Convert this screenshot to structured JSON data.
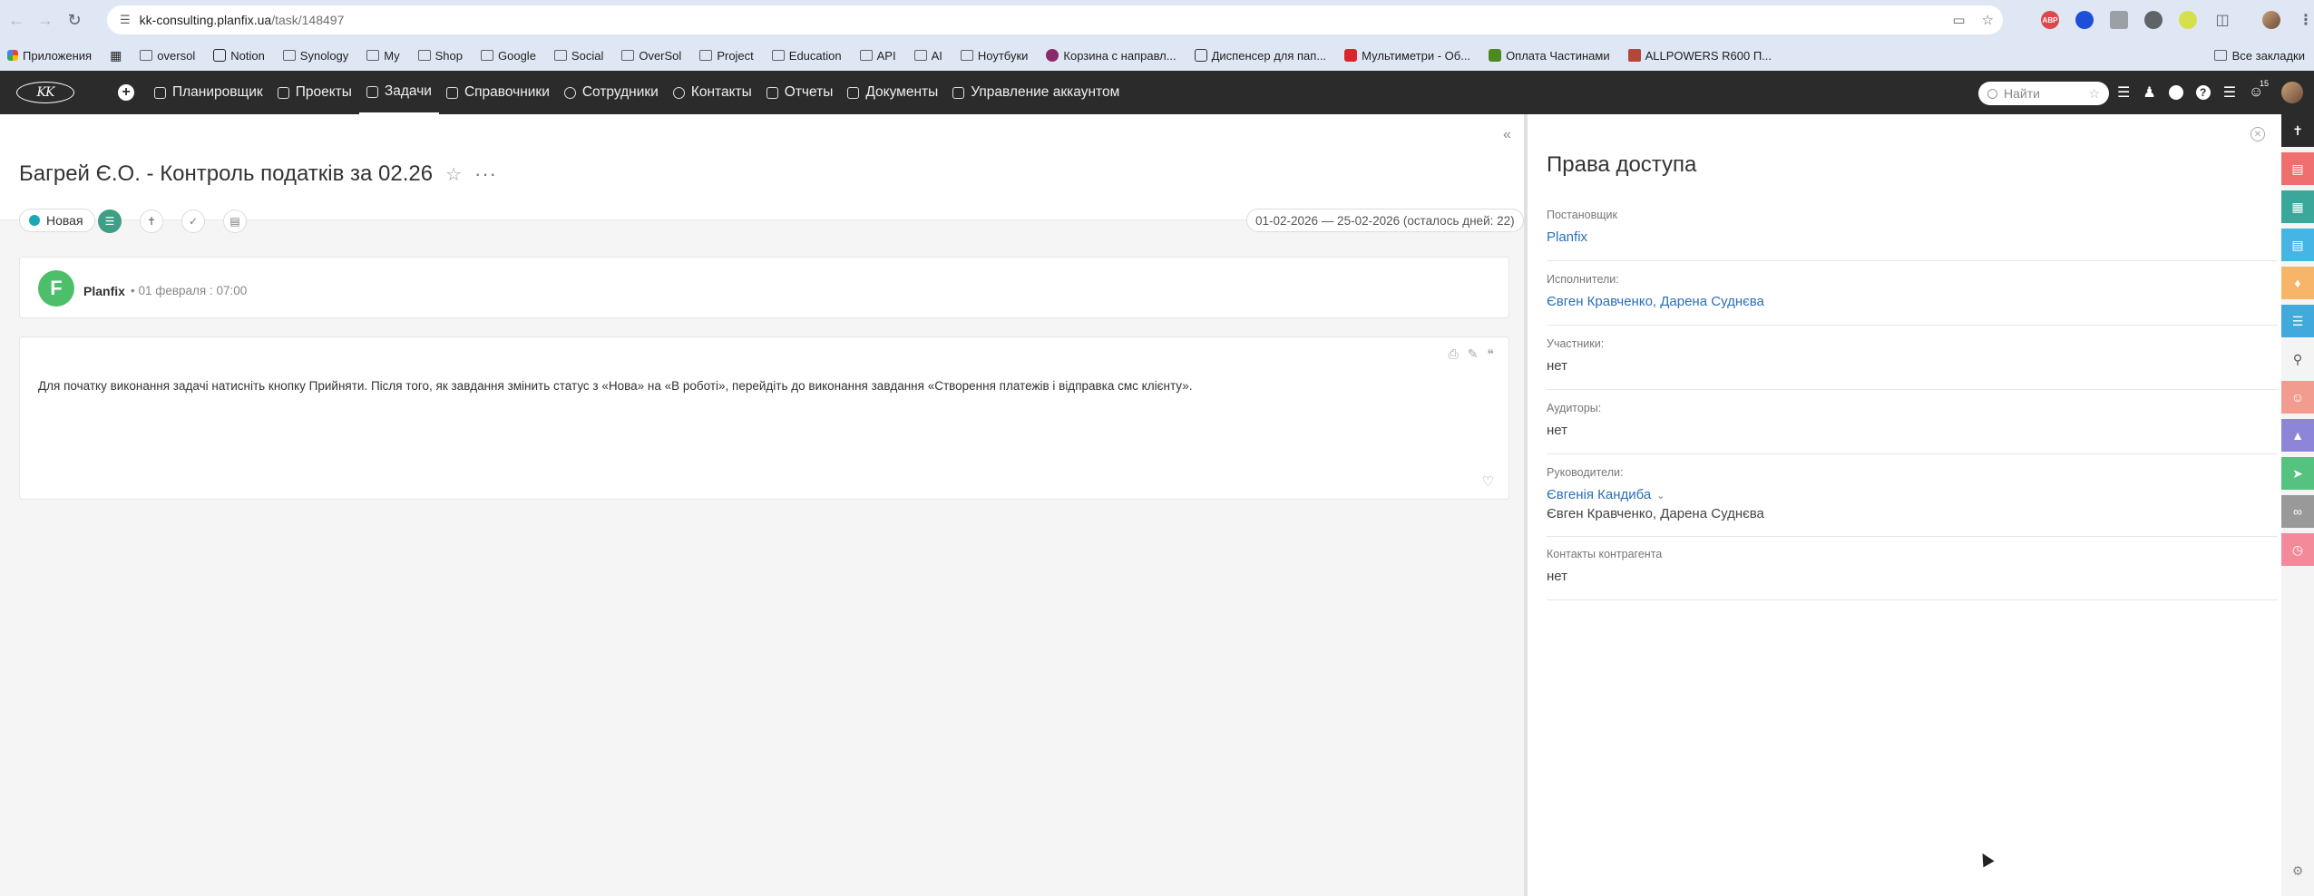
{
  "browser": {
    "url_host": "kk-consulting.planfix.ua",
    "url_path": "/task/148497",
    "bookmarks": [
      {
        "label": "Приложения"
      },
      {
        "label": ""
      },
      {
        "label": "oversol"
      },
      {
        "label": "Notion"
      },
      {
        "label": "Synology"
      },
      {
        "label": "My"
      },
      {
        "label": "Shop"
      },
      {
        "label": "Google"
      },
      {
        "label": "Social"
      },
      {
        "label": "OverSol"
      },
      {
        "label": "Project"
      },
      {
        "label": "Education"
      },
      {
        "label": "API"
      },
      {
        "label": "AI"
      },
      {
        "label": "Ноутбуки"
      },
      {
        "label": "Корзина с направл..."
      },
      {
        "label": "Диспенсер для пап..."
      },
      {
        "label": "Мультиметри - Об..."
      },
      {
        "label": "Оплата Частинами"
      },
      {
        "label": "ALLPOWERS R600 П..."
      }
    ],
    "all_bookmarks": "Все закладки"
  },
  "app": {
    "logo": "KK",
    "menu": [
      {
        "label": "Планировщик"
      },
      {
        "label": "Проекты"
      },
      {
        "label": "Задачи"
      },
      {
        "label": "Справочники"
      },
      {
        "label": "Сотрудники"
      },
      {
        "label": "Контакты"
      },
      {
        "label": "Отчеты"
      },
      {
        "label": "Документы"
      },
      {
        "label": "Управление аккаунтом"
      }
    ],
    "search_placeholder": "Найти",
    "notification_count": "15"
  },
  "task": {
    "title": "Багрей Є.О. - Контроль податків за 02.26",
    "status": "Новая",
    "dates": "01-02-2026 — 25-02-2026  (осталось дней: 22)",
    "author": "Planfix",
    "author_date": "• 01 февраля : 07:00",
    "description": "Для початку виконання задачі натисніть кнопку Прийняти. Після того, як завдання змінить статус з «Нова» на «В роботі», перейдіть до виконання завдання «Створення платежів і відправка смс клієнту»."
  },
  "panel": {
    "title": "Права доступа",
    "fields": [
      {
        "label": "Постановщик",
        "value": "Planfix"
      },
      {
        "label": "Исполнители:",
        "value": "Євген Кравченко, Дарена Суднєва"
      },
      {
        "label": "Участники:",
        "value": "нет"
      },
      {
        "label": "Аудиторы:",
        "value": "нет"
      },
      {
        "label": "Руководители:",
        "value": "Євгенія Кандиба",
        "value2": "Євген Кравченко, Дарена Суднєва"
      },
      {
        "label": "Контакты контрагента",
        "value": "нет"
      }
    ]
  },
  "colors": {
    "status_dot": "#1aa7b6",
    "link": "#2b6fb8",
    "topbar": "#2b2b2b"
  }
}
